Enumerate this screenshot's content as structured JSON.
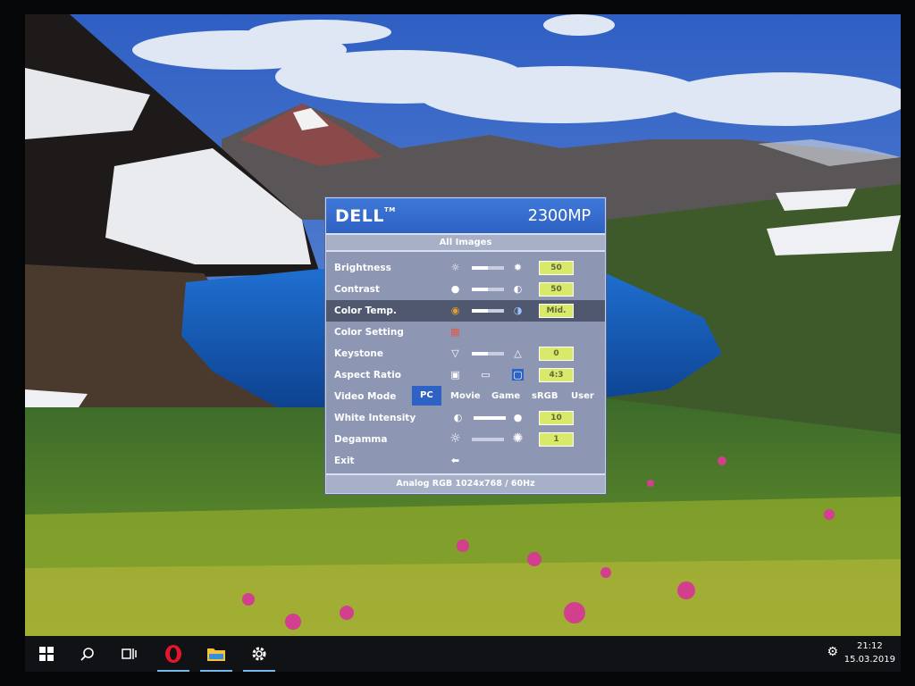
{
  "osd": {
    "brand": "DELL",
    "trademark": "TM",
    "model": "2300MP",
    "subtitle": "All Images",
    "footer": "Analog RGB 1024x768 / 60Hz",
    "items": [
      {
        "label": "Brightness",
        "value": "50",
        "level": 0.5
      },
      {
        "label": "Contrast",
        "value": "50",
        "level": 0.5
      },
      {
        "label": "Color Temp.",
        "value": "Mid.",
        "level": 0.5
      },
      {
        "label": "Color Setting"
      },
      {
        "label": "Keystone",
        "value": "0",
        "level": 0.5
      },
      {
        "label": "Aspect Ratio",
        "value": "4:3"
      },
      {
        "label": "Video Mode"
      },
      {
        "label": "White Intensity",
        "value": "10",
        "level": 1.0
      },
      {
        "label": "Degamma",
        "value": "1",
        "level": 0.0
      },
      {
        "label": "Exit"
      }
    ],
    "video_modes": [
      "PC",
      "Movie",
      "Game",
      "sRGB",
      "User"
    ],
    "selected_item": "Color Temp.",
    "selected_video_mode": "PC"
  },
  "taskbar": {
    "apps": [
      "windows-start",
      "search",
      "task-view",
      "opera",
      "file-explorer",
      "settings"
    ],
    "time": "21:12",
    "date": "15.03.2019"
  },
  "colors": {
    "accent": "#2e62c4",
    "osd_bg": "#8d96b3",
    "value_box": "#d9e96a"
  }
}
